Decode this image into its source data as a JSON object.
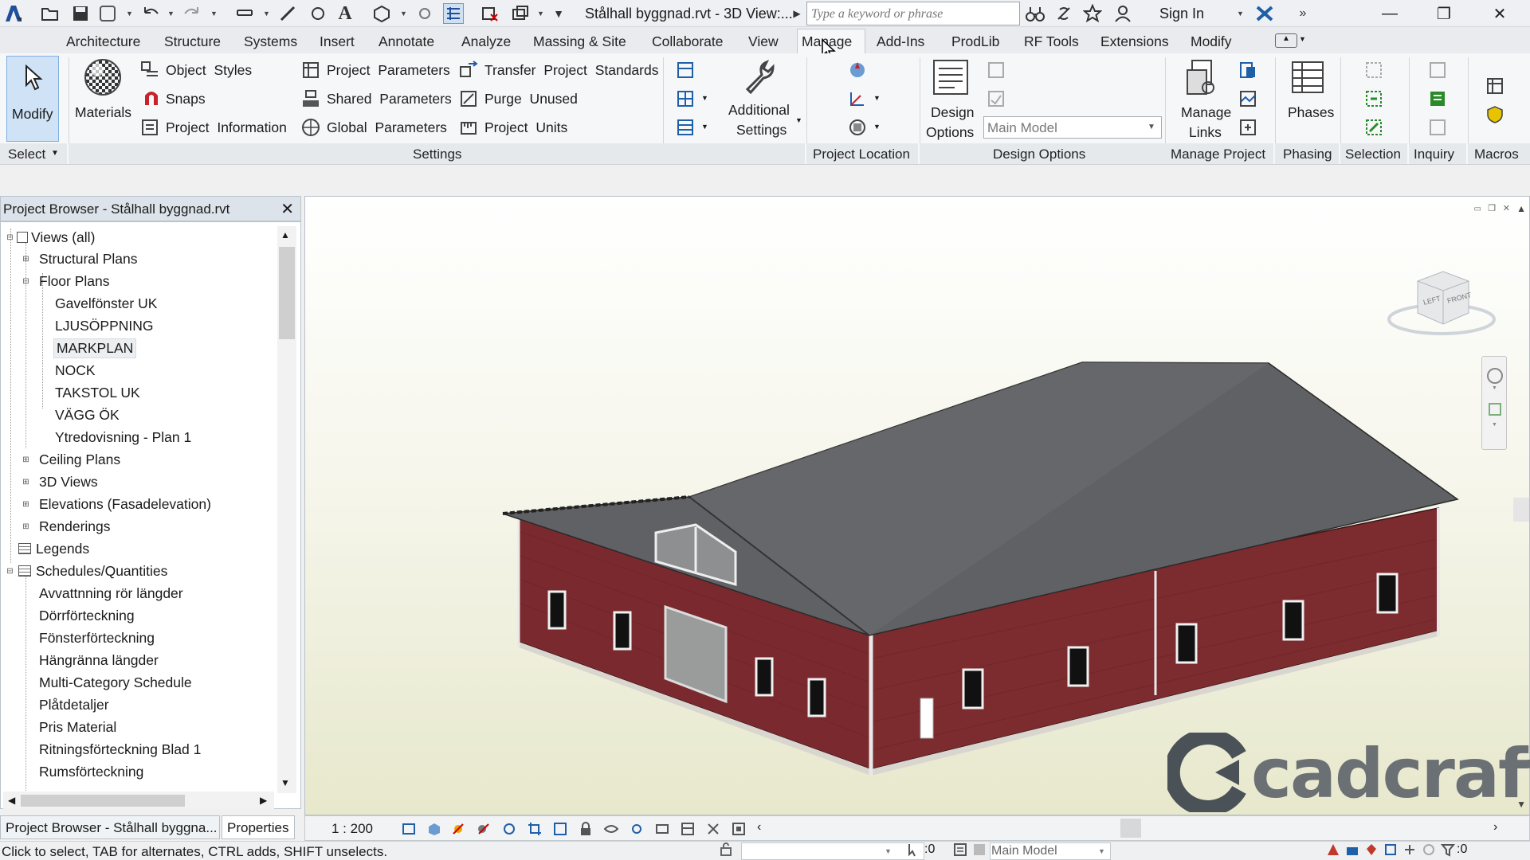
{
  "app": {
    "title": "Stålhall byggnad.rvt - 3D View:...",
    "search_placeholder": "Type a keyword or phrase",
    "sign_in": "Sign In",
    "accent": "#1f5fa8"
  },
  "tabs": [
    {
      "label": "Architecture"
    },
    {
      "label": "Structure"
    },
    {
      "label": "Systems"
    },
    {
      "label": "Insert"
    },
    {
      "label": "Annotate"
    },
    {
      "label": "Analyze"
    },
    {
      "label": "Massing & Site"
    },
    {
      "label": "Collaborate"
    },
    {
      "label": "View"
    },
    {
      "label": "Manage",
      "active": true
    },
    {
      "label": "Add-Ins"
    },
    {
      "label": "ProdLib"
    },
    {
      "label": "RF Tools"
    },
    {
      "label": "Extensions"
    },
    {
      "label": "Modify"
    }
  ],
  "ribbon": {
    "modify": "Modify",
    "materials": "Materials",
    "object_styles": "Object Styles",
    "snaps": "Snaps",
    "project_information": "Project Information",
    "project_parameters": "Project Parameters",
    "shared_parameters": "Shared Parameters",
    "global_parameters": "Global Parameters",
    "transfer_project_standards": "Transfer Project Standards",
    "purge_unused": "Purge Unused",
    "project_units": "Project Units",
    "additional_settings_1": "Additional",
    "additional_settings_2": "Settings",
    "design_options_1": "Design",
    "design_options_2": "Options",
    "design_option_select": "Main Model",
    "manage_links_1": "Manage",
    "manage_links_2": "Links",
    "phases": "Phases",
    "panels": {
      "select": "Select",
      "settings": "Settings",
      "project_location": "Project Location",
      "design_options": "Design Options",
      "manage_project": "Manage Project",
      "phasing": "Phasing",
      "selection": "Selection",
      "inquiry": "Inquiry",
      "macros": "Macros"
    }
  },
  "project_browser": {
    "title": "Project Browser - Stålhall byggnad.rvt",
    "items": [
      {
        "label": "Views (all)",
        "level": 0,
        "toggle": "-"
      },
      {
        "label": "Structural Plans",
        "level": 1,
        "toggle": "+"
      },
      {
        "label": "Floor Plans",
        "level": 1,
        "toggle": "-"
      },
      {
        "label": "Gavelfönster UK",
        "level": 2
      },
      {
        "label": "LJUSÖPPNING",
        "level": 2
      },
      {
        "label": "MARKPLAN",
        "level": 2,
        "selected": true
      },
      {
        "label": "NOCK",
        "level": 2
      },
      {
        "label": "TAKSTOL UK",
        "level": 2
      },
      {
        "label": "VÄGG ÖK",
        "level": 2
      },
      {
        "label": "Ytredovisning - Plan 1",
        "level": 2
      },
      {
        "label": "Ceiling Plans",
        "level": 1,
        "toggle": "+"
      },
      {
        "label": "3D Views",
        "level": 1,
        "toggle": "+"
      },
      {
        "label": "Elevations (Fasadelevation)",
        "level": 1,
        "toggle": "+"
      },
      {
        "label": "Renderings",
        "level": 1,
        "toggle": "+"
      },
      {
        "label": "Legends",
        "level": 0
      },
      {
        "label": "Schedules/Quantities",
        "level": 0,
        "toggle": "-"
      },
      {
        "label": "Avvattnning rör längder",
        "level": 1
      },
      {
        "label": "Dörrförteckning",
        "level": 1
      },
      {
        "label": "Fönsterförteckning",
        "level": 1
      },
      {
        "label": "Hängränna längder",
        "level": 1
      },
      {
        "label": "Multi-Category Schedule",
        "level": 1
      },
      {
        "label": "Plåtdetaljer",
        "level": 1
      },
      {
        "label": "Pris Material",
        "level": 1
      },
      {
        "label": "Ritningsförteckning Blad 1",
        "level": 1
      },
      {
        "label": "Rumsförteckning",
        "level": 1
      }
    ]
  },
  "bottom_tabs": {
    "browser": "Project Browser - Stålhall byggna...",
    "properties": "Properties"
  },
  "view": {
    "scale": "1 : 200",
    "viewcube_left": "LEFT",
    "viewcube_front": "FRONT"
  },
  "status": {
    "text": "Click to select, TAB for alternates, CTRL adds, SHIFT unselects.",
    "count": ":0",
    "model": "Main Model",
    "filter_count": ":0"
  },
  "watermark": "cadcraft",
  "colors": {
    "wall": "#7a2a2e",
    "roof": "#5f6164"
  }
}
